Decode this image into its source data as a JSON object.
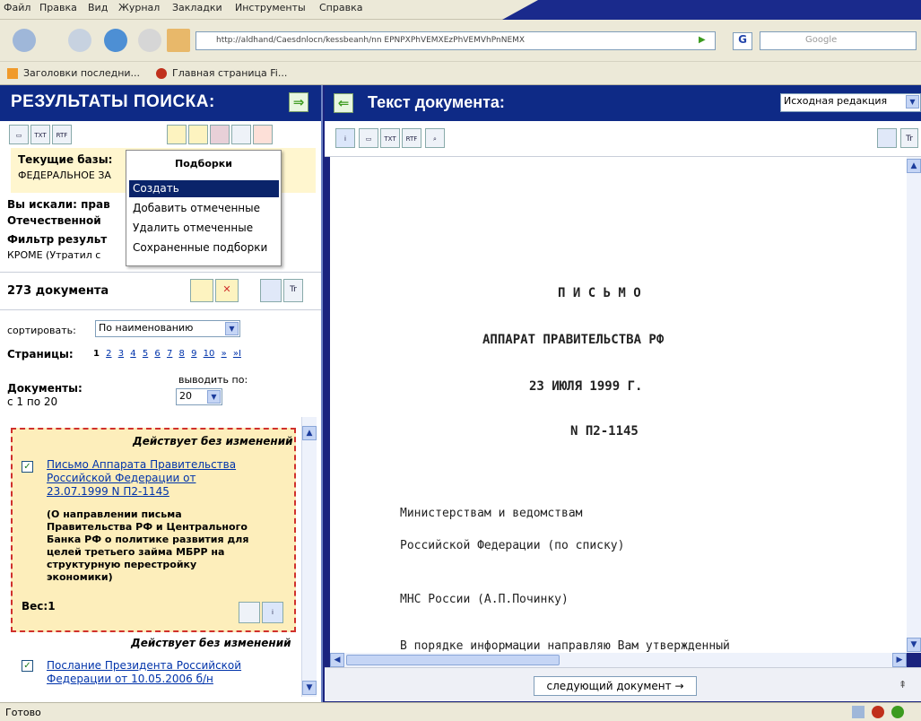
{
  "browser": {
    "menu": [
      "Файл",
      "Правка",
      "Вид",
      "Журнал",
      "Закладки",
      "Инструменты",
      "Справка"
    ],
    "address": "http://aldhand/Caesdnlocn/kessbeanh/nn EPNPXPhVEMXEzPhVEMVhPnNEMX",
    "search_placeholder": "Google",
    "bookmarks": [
      "Заголовки последни...",
      "Главная страница Fi..."
    ],
    "status": "Готово"
  },
  "left": {
    "title": "РЕЗУЛЬТАТЫ ПОИСКА:",
    "txt": "TXT",
    "rtf": "RTF",
    "current_base_label": "Текущие базы:",
    "current_base_value": "ФЕДЕРАЛЬНОЕ ЗА",
    "searched_label": "Вы искали: прав",
    "searched_value": "Отечественной",
    "filter_label": "Фильтр результ",
    "filter_value": "КРОМЕ (Утратил с",
    "doc_count": "273 документа",
    "sort_label": "сортировать:",
    "sort_value": "По наименованию",
    "pages_label": "Страницы:",
    "pages": [
      "1",
      "2",
      "3",
      "4",
      "5",
      "6",
      "7",
      "8",
      "9",
      "10",
      "»",
      "»I"
    ],
    "docs_label": "Документы:",
    "docs_range": "с 1 по 20",
    "per_page_label": "выводить по:",
    "per_page_value": "20",
    "results": [
      {
        "status": "Действует без изменений",
        "title_lines": [
          "Письмо Аппарата Правительства",
          "Российской Федерации от",
          "23.07.1999 N П2-1145"
        ],
        "note_lines": [
          "(О направлении письма",
          "Правительства РФ и Центрального",
          "Банка РФ о политике развития для",
          "целей третьего займа МБРР на",
          "структурную перестройку",
          "экономики)"
        ],
        "weight": "Вес:1"
      },
      {
        "status": "Действует без изменений",
        "title_lines": [
          "Послание Президента Российской",
          "Федерации от 10.05.2006 б/н"
        ]
      }
    ]
  },
  "menu": {
    "title": "Подборки",
    "items": [
      "Создать",
      "Добавить отмеченные",
      "Удалить отмеченные",
      "Сохраненные подборки"
    ]
  },
  "right": {
    "title": "Текст документа:",
    "edition": "Исходная редакция",
    "txt": "TXT",
    "rtf": "RTF",
    "doc_lines": [
      "П И С Ь М О",
      "АППАРАТ ПРАВИТЕЛЬСТВА РФ",
      "23 ИЮЛЯ 1999 Г.",
      "N П2-1145",
      "Министерствам и ведомствам",
      "Российской Федерации (по списку)",
      "МНС России (А.П.Починку)",
      "В порядке информации направляю Вам утвержденный"
    ],
    "next_doc": "следующий документ →"
  }
}
